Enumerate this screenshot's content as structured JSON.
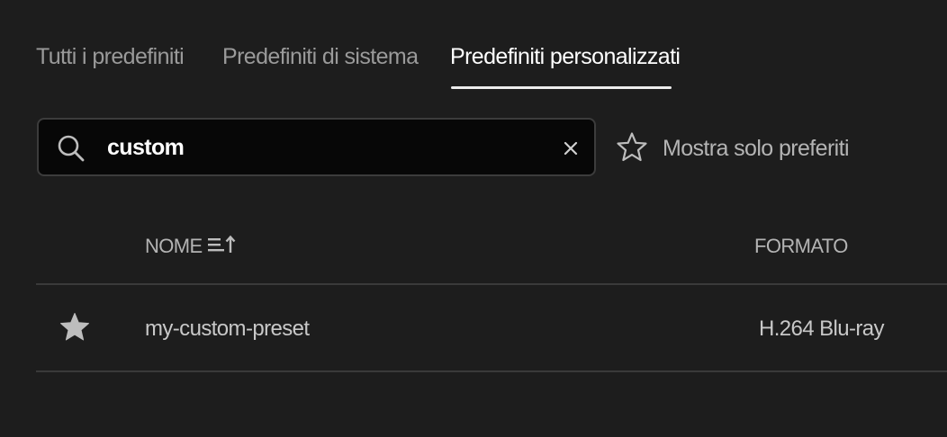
{
  "tabs": [
    {
      "label": "Tutti i predefiniti",
      "active": false
    },
    {
      "label": "Predefiniti di sistema",
      "active": false
    },
    {
      "label": "Predefiniti personalizzati",
      "active": true
    }
  ],
  "search": {
    "value": "custom",
    "icon": "search-icon",
    "clear_icon": "close-icon"
  },
  "favorites_filter": {
    "label": "Mostra solo preferiti",
    "icon": "star-outline-icon"
  },
  "table": {
    "columns": {
      "name": "NOME",
      "format": "FORMATO"
    },
    "sort_icon": "sort-ascending-icon",
    "rows": [
      {
        "favorite": true,
        "name": "my-custom-preset",
        "format": "H.264 Blu-ray"
      }
    ]
  },
  "colors": {
    "background": "#1d1d1d",
    "search_background": "#070707",
    "active_tab": "#ffffff",
    "inactive_tab": "#9a9a9a",
    "divider": "#3a3a3a"
  }
}
